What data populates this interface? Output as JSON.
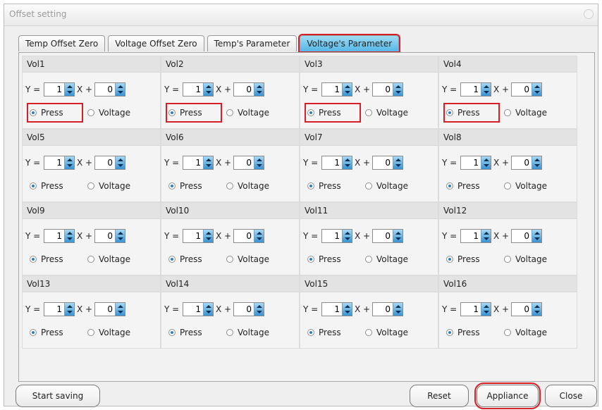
{
  "window": {
    "title": "Offset setting"
  },
  "tabs": [
    {
      "label": "Temp Offset Zero"
    },
    {
      "label": "Voltage Offset Zero"
    },
    {
      "label": "Temp's Parameter"
    },
    {
      "label": "Voltage's Parameter"
    }
  ],
  "active_tab": "Voltage's Parameter",
  "groups": [
    {
      "name": "Vol1",
      "y": "1",
      "x": "0",
      "mode": "Press",
      "highlight_press": true
    },
    {
      "name": "Vol2",
      "y": "1",
      "x": "0",
      "mode": "Press",
      "highlight_press": true
    },
    {
      "name": "Vol3",
      "y": "1",
      "x": "0",
      "mode": "Press",
      "highlight_press": true
    },
    {
      "name": "Vol4",
      "y": "1",
      "x": "0",
      "mode": "Press",
      "highlight_press": true
    },
    {
      "name": "Vol5",
      "y": "1",
      "x": "0",
      "mode": "Press",
      "highlight_press": false
    },
    {
      "name": "Vol6",
      "y": "1",
      "x": "0",
      "mode": "Press",
      "highlight_press": false
    },
    {
      "name": "Vol7",
      "y": "1",
      "x": "0",
      "mode": "Press",
      "highlight_press": false
    },
    {
      "name": "Vol8",
      "y": "1",
      "x": "0",
      "mode": "Press",
      "highlight_press": false
    },
    {
      "name": "Vol9",
      "y": "1",
      "x": "0",
      "mode": "Press",
      "highlight_press": false
    },
    {
      "name": "Vol10",
      "y": "1",
      "x": "0",
      "mode": "Press",
      "highlight_press": false
    },
    {
      "name": "Vol11",
      "y": "1",
      "x": "0",
      "mode": "Press",
      "highlight_press": false
    },
    {
      "name": "Vol12",
      "y": "1",
      "x": "0",
      "mode": "Press",
      "highlight_press": false
    },
    {
      "name": "Vol13",
      "y": "1",
      "x": "0",
      "mode": "Press",
      "highlight_press": false
    },
    {
      "name": "Vol14",
      "y": "1",
      "x": "0",
      "mode": "Press",
      "highlight_press": false
    },
    {
      "name": "Vol15",
      "y": "1",
      "x": "0",
      "mode": "Press",
      "highlight_press": false
    },
    {
      "name": "Vol16",
      "y": "1",
      "x": "0",
      "mode": "Press",
      "highlight_press": false
    }
  ],
  "labels": {
    "y_eq": "Y =",
    "x_plus": "X +",
    "press": "Press",
    "voltage": "Voltage"
  },
  "buttons": {
    "start_saving": "Start saving",
    "reset": "Reset",
    "appliance": "Appliance",
    "close": "Close"
  },
  "colors": {
    "highlight": "#d61f26",
    "active_tab": "#54b7e6",
    "spin": "#3a93d1"
  },
  "icons": {
    "spin": "spin-arrows-icon",
    "radio": "radio-button-icon"
  }
}
